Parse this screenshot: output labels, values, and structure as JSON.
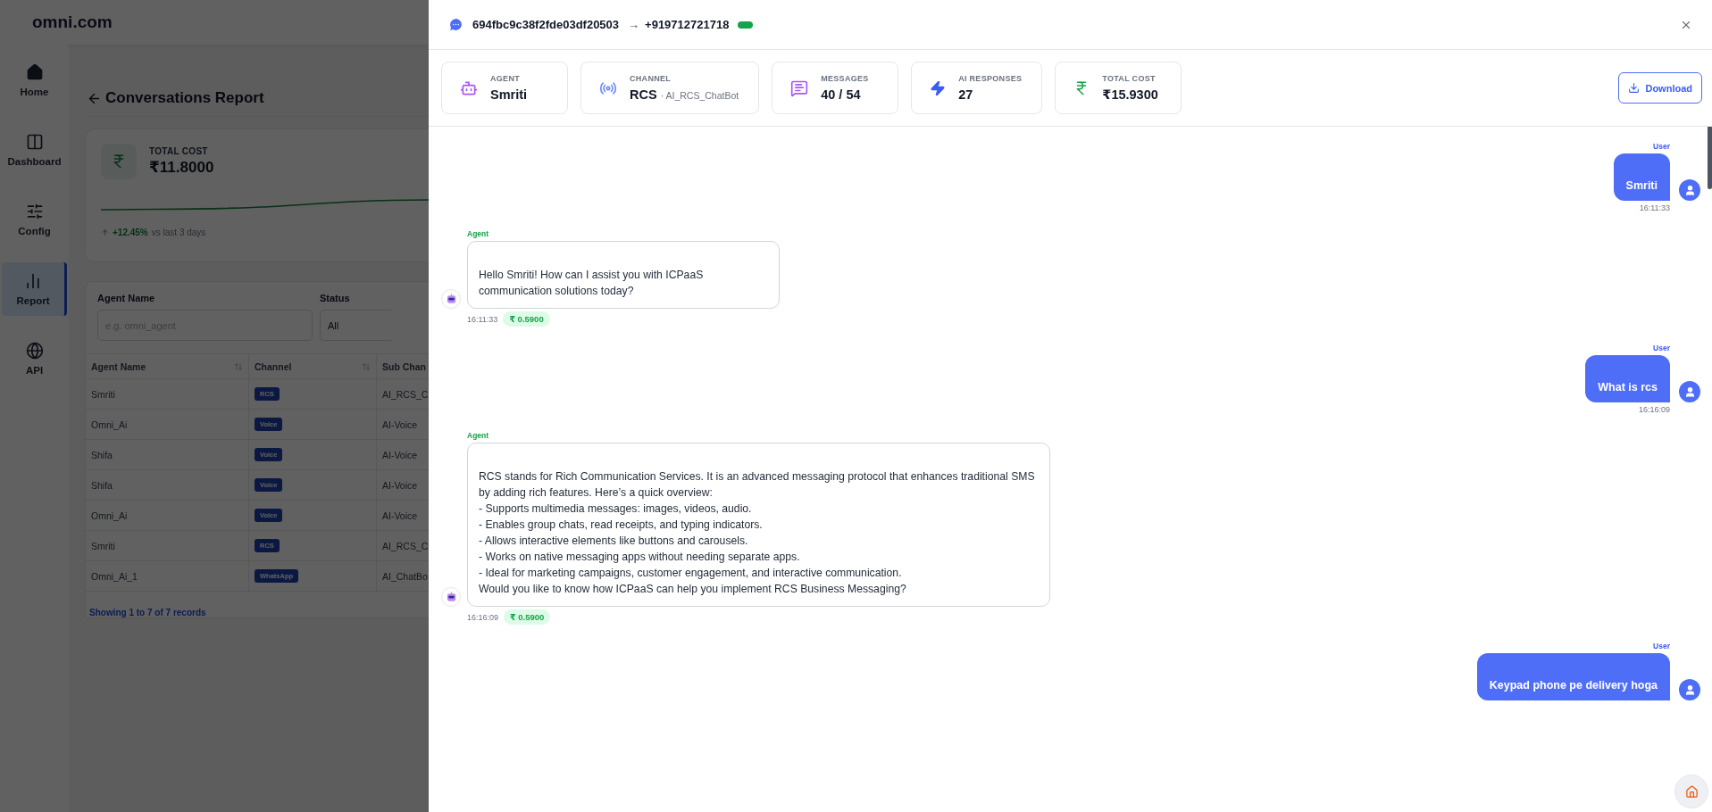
{
  "background_app": {
    "brand": "omni.com",
    "nav": [
      {
        "label": "Home",
        "selected": false
      },
      {
        "label": "Dashboard",
        "selected": false
      },
      {
        "label": "Config",
        "selected": false
      },
      {
        "label": "Report",
        "selected": true
      },
      {
        "label": "API",
        "selected": false
      }
    ],
    "page_title": "Conversations Report",
    "cost_card": {
      "label": "TOTAL COST",
      "value": "₹11.8000",
      "trend": "+12.45%",
      "trend_note": "vs last 3 days"
    },
    "filters": [
      {
        "label": "Agent Name",
        "placeholder": "e.g. omni_agent"
      },
      {
        "label": "Status",
        "value": "All"
      }
    ],
    "table": {
      "columns": [
        "Agent Name",
        "Channel",
        "Sub Chan"
      ],
      "rows": [
        {
          "agent": "Smriti",
          "channel": "RCS",
          "sub_channel": "AI_RCS_C"
        },
        {
          "agent": "Omni_Ai",
          "channel": "Voice",
          "sub_channel": "AI-Voice"
        },
        {
          "agent": "Shifa",
          "channel": "Voice",
          "sub_channel": "AI-Voice"
        },
        {
          "agent": "Shifa",
          "channel": "Voice",
          "sub_channel": "AI-Voice"
        },
        {
          "agent": "Omni_Ai",
          "channel": "Voice",
          "sub_channel": "AI-Voice"
        },
        {
          "agent": "Smriti",
          "channel": "RCS",
          "sub_channel": "AI_RCS_C"
        },
        {
          "agent": "Omni_Ai_1",
          "channel": "WhatsApp",
          "sub_channel": "AI_ChatBo"
        }
      ]
    },
    "footer": "Showing 1 to 7 of 7 records"
  },
  "drawer": {
    "conversation_id": "694fbc9c38f2fde03df20503",
    "arrow": "→",
    "phone": "+919712721718",
    "stats": [
      {
        "kind": "agent",
        "label": "AGENT",
        "value": "Smriti"
      },
      {
        "kind": "channel",
        "label": "CHANNEL",
        "value": "RCS",
        "sub": "· AI_RCS_ChatBot"
      },
      {
        "kind": "messages",
        "label": "MESSAGES",
        "value": "40 / 54"
      },
      {
        "kind": "ai",
        "label": "AI RESPONSES",
        "value": "27"
      },
      {
        "kind": "cost",
        "label": "TOTAL COST",
        "value": "₹15.9300"
      }
    ],
    "download": "Download",
    "messages": [
      {
        "kind": "user",
        "label": "User",
        "text": "Smriti",
        "time": "16:11:33"
      },
      {
        "kind": "agent",
        "label": "Agent",
        "text": "Hello Smriti! How can I assist you with ICPaaS\ncommunication solutions today?",
        "time": "16:11:33",
        "cost": "₹ 0.5900"
      },
      {
        "kind": "user",
        "label": "User",
        "text": "What is rcs",
        "time": "16:16:09"
      },
      {
        "kind": "agent",
        "label": "Agent",
        "text": "RCS stands for Rich Communication Services. It is an advanced messaging protocol that enhances traditional SMS\nby adding rich features. Here’s a quick overview:\n- Supports multimedia messages: images, videos, audio.\n- Enables group chats, read receipts, and typing indicators.\n- Allows interactive elements like buttons and carousels.\n- Works on native messaging apps without needing separate apps.\n- Ideal for marketing campaigns, customer engagement, and interactive communication.\nWould you like to know how ICPaaS can help you implement RCS Business Messaging?",
        "time": "16:16:09",
        "cost": "₹ 0.5900"
      },
      {
        "kind": "user",
        "label": "User",
        "text": "Keypad phone pe delivery hoga"
      }
    ]
  }
}
